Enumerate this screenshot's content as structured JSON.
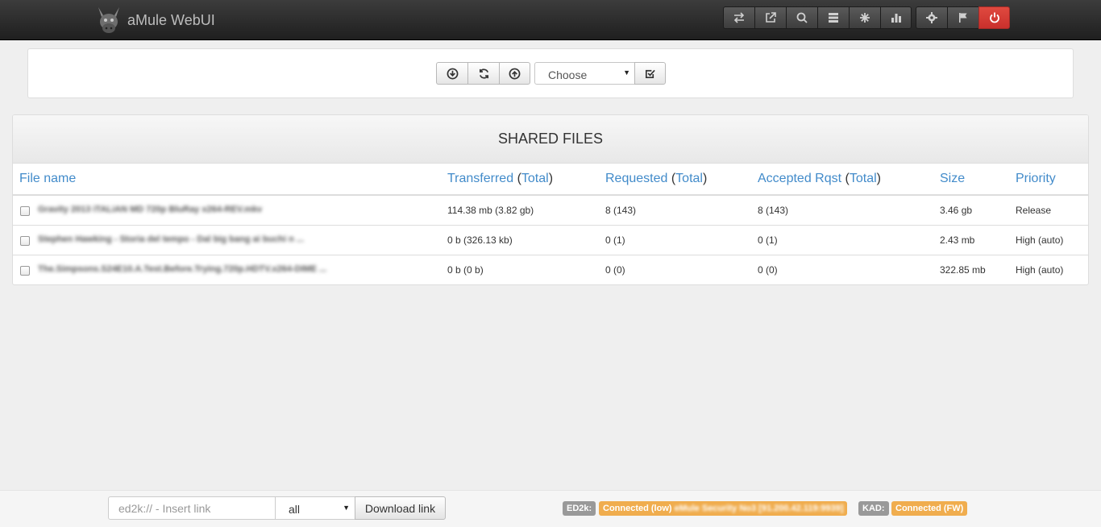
{
  "app": {
    "title": "aMule WebUI"
  },
  "navbar": {
    "buttons": [
      {
        "name": "transfers-icon",
        "label": "Transfers"
      },
      {
        "name": "share-icon",
        "label": "Shared"
      },
      {
        "name": "search-icon",
        "label": "Search"
      },
      {
        "name": "servers-icon",
        "label": "Servers"
      },
      {
        "name": "kad-icon",
        "label": "Kad"
      },
      {
        "name": "stats-icon",
        "label": "Statistics"
      },
      {
        "name": "settings-icon",
        "label": "Preferences"
      },
      {
        "name": "flag-icon",
        "label": "Log"
      },
      {
        "name": "power-icon",
        "label": "Logout"
      }
    ],
    "danger_color": "#d9534f"
  },
  "toolbar": {
    "buttons": [
      "download-circle-icon",
      "refresh-icon",
      "upload-circle-icon"
    ],
    "select_value": "Choose",
    "apply_icon": "check-square-icon"
  },
  "shared": {
    "title": "SHARED FILES",
    "columns": {
      "file_name": "File name",
      "transferred": "Transferred",
      "requested": "Requested",
      "accepted": "Accepted Rqst",
      "total": "Total",
      "size": "Size",
      "priority": "Priority"
    },
    "rows": [
      {
        "name": "Gravity 2013 iTALiAN MD 720p BluRay x264-REV.mkv",
        "transferred": "114.38 mb (3.82 gb)",
        "requested": "8 (143)",
        "accepted": "8 (143)",
        "size": "3.46 gb",
        "priority": "Release"
      },
      {
        "name": "Stephen Hawking - Storia del tempo - Dal big bang ai buchi n ...",
        "transferred": "0 b (326.13 kb)",
        "requested": "0 (1)",
        "accepted": "0 (1)",
        "size": "2.43 mb",
        "priority": "High (auto)"
      },
      {
        "name": "The.Simpsons.S24E10.A.Test.Before.Trying.720p.HDTV.x264-DIME ...",
        "transferred": "0 b (0 b)",
        "requested": "0 (0)",
        "accepted": "0 (0)",
        "size": "322.85 mb",
        "priority": "High (auto)"
      }
    ]
  },
  "footer": {
    "link_placeholder": "ed2k:// - Insert link",
    "category_value": "all",
    "download_label": "Download link",
    "ed2k_label": "ED2k:",
    "ed2k_status": "Connected (low)",
    "ed2k_server": "eMule Security No3 [91.200.42.119:9939]",
    "kad_label": "KAD:",
    "kad_status": "Connected (FW)",
    "status_color": "#f0ad4e",
    "label_color": "#999999"
  }
}
